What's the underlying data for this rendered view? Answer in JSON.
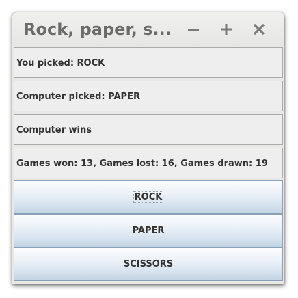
{
  "window": {
    "title": "Rock, paper, s..."
  },
  "title_controls": {
    "minimize_icon": "minimize-icon",
    "maximize_icon": "maximize-icon",
    "close_icon": "close-icon"
  },
  "info": {
    "you_picked": "You picked: ROCK",
    "computer_picked": "Computer picked: PAPER",
    "result": "Computer wins",
    "stats": "Games won: 13, Games lost: 16, Games drawn: 19"
  },
  "buttons": {
    "rock": "ROCK",
    "paper": "PAPER",
    "scissors": "SCISSORS"
  },
  "colors": {
    "title_text": "#6b6b6b",
    "button_border": "#8aa0b6",
    "panel_border": "#a9a9a9"
  }
}
